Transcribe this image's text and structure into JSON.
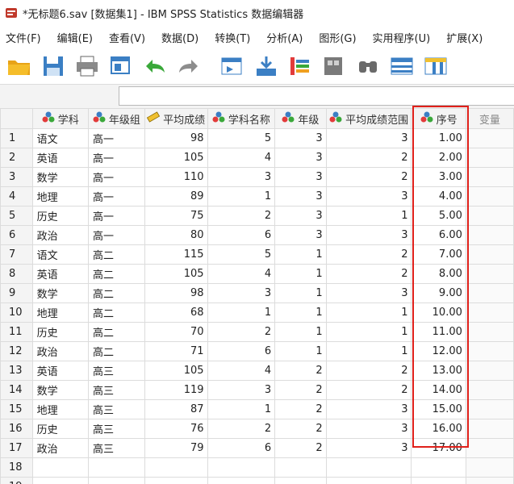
{
  "window": {
    "title": "*无标题6.sav [数据集1] - IBM SPSS Statistics 数据编辑器"
  },
  "menu": [
    "文件(F)",
    "编辑(E)",
    "查看(V)",
    "数据(D)",
    "转换(T)",
    "分析(A)",
    "图形(G)",
    "实用程序(U)",
    "扩展(X)"
  ],
  "toolbar": {
    "icons": [
      "open-folder-icon",
      "save-icon",
      "print-icon",
      "dialog-recall-icon",
      "undo-icon",
      "redo-icon",
      "goto-case-icon",
      "goto-variable-icon",
      "variables-icon",
      "run-descriptives-icon",
      "find-icon",
      "insert-cases-icon",
      "insert-variable-icon"
    ]
  },
  "columns": [
    {
      "label": "学科",
      "type": "nominal"
    },
    {
      "label": "年级组",
      "type": "nominal"
    },
    {
      "label": "平均成绩",
      "type": "scale"
    },
    {
      "label": "学科名称",
      "type": "nominal"
    },
    {
      "label": "年级",
      "type": "nominal"
    },
    {
      "label": "平均成绩范围",
      "type": "nominal"
    },
    {
      "label": "序号",
      "type": "nominal"
    },
    {
      "label": "变量",
      "type": "empty"
    }
  ],
  "rows": [
    [
      "1",
      "语文",
      "高一",
      "98",
      "5",
      "3",
      "3",
      "1.00"
    ],
    [
      "2",
      "英语",
      "高一",
      "105",
      "4",
      "3",
      "2",
      "2.00"
    ],
    [
      "3",
      "数学",
      "高一",
      "110",
      "3",
      "3",
      "2",
      "3.00"
    ],
    [
      "4",
      "地理",
      "高一",
      "89",
      "1",
      "3",
      "3",
      "4.00"
    ],
    [
      "5",
      "历史",
      "高一",
      "75",
      "2",
      "3",
      "1",
      "5.00"
    ],
    [
      "6",
      "政治",
      "高一",
      "80",
      "6",
      "3",
      "3",
      "6.00"
    ],
    [
      "7",
      "语文",
      "高二",
      "115",
      "5",
      "1",
      "2",
      "7.00"
    ],
    [
      "8",
      "英语",
      "高二",
      "105",
      "4",
      "1",
      "2",
      "8.00"
    ],
    [
      "9",
      "数学",
      "高二",
      "98",
      "3",
      "1",
      "3",
      "9.00"
    ],
    [
      "10",
      "地理",
      "高二",
      "68",
      "1",
      "1",
      "1",
      "10.00"
    ],
    [
      "11",
      "历史",
      "高二",
      "70",
      "2",
      "1",
      "1",
      "11.00"
    ],
    [
      "12",
      "政治",
      "高二",
      "71",
      "6",
      "1",
      "1",
      "12.00"
    ],
    [
      "13",
      "英语",
      "高三",
      "105",
      "4",
      "2",
      "2",
      "13.00"
    ],
    [
      "14",
      "数学",
      "高三",
      "119",
      "3",
      "2",
      "2",
      "14.00"
    ],
    [
      "15",
      "地理",
      "高三",
      "87",
      "1",
      "2",
      "3",
      "15.00"
    ],
    [
      "16",
      "历史",
      "高三",
      "76",
      "2",
      "2",
      "3",
      "16.00"
    ],
    [
      "17",
      "政治",
      "高三",
      "79",
      "6",
      "2",
      "3",
      "17.00"
    ],
    [
      "18",
      "",
      "",
      "",
      "",
      "",
      "",
      ""
    ],
    [
      "19",
      "",
      "",
      "",
      "",
      "",
      "",
      ""
    ]
  ],
  "highlight_color": "#e0201a"
}
